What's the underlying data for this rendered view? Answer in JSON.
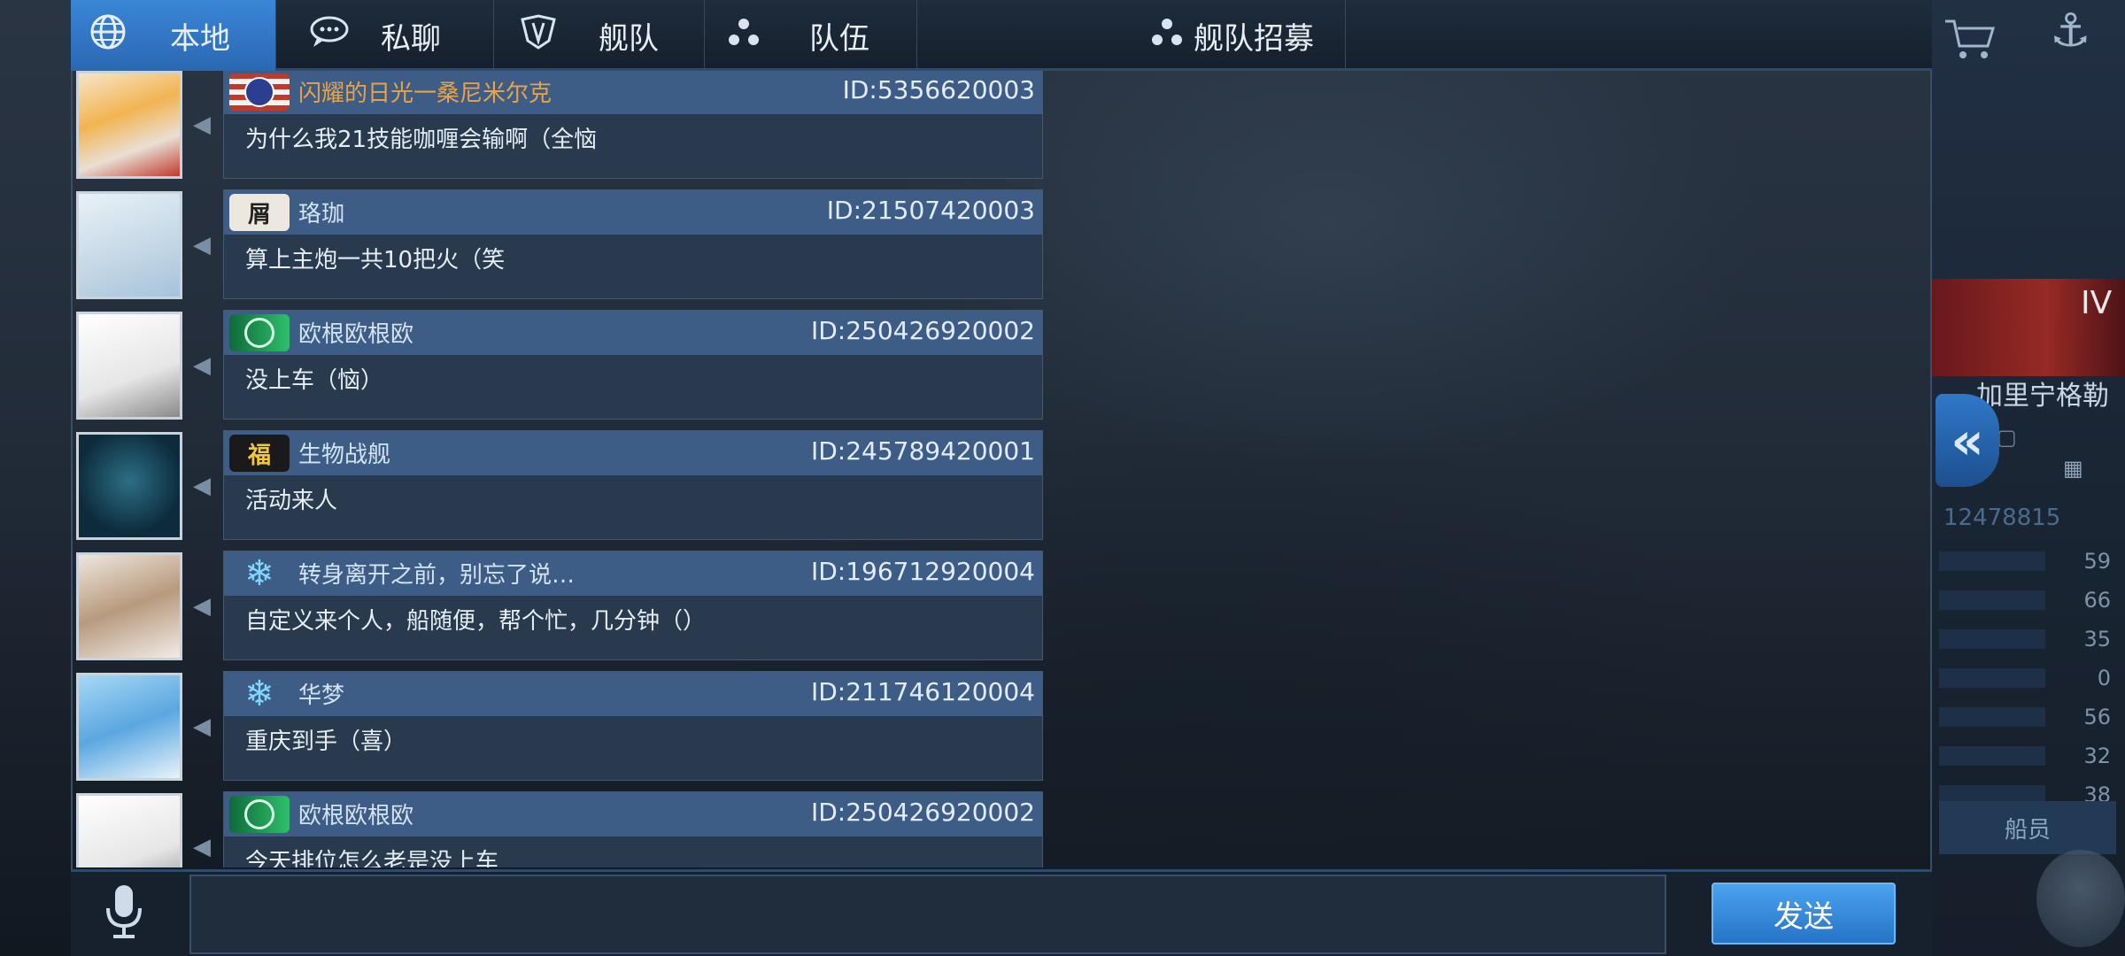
{
  "tabs": [
    {
      "label": "本地",
      "icon": "globe-icon",
      "active": true
    },
    {
      "label": "私聊",
      "icon": "chat-bubble-icon",
      "active": false
    },
    {
      "label": "舰队",
      "icon": "fleet-emblem-icon",
      "active": false
    },
    {
      "label": "队伍",
      "icon": "team-dots-icon",
      "active": false
    },
    {
      "label": "舰队招募",
      "icon": "team-dots-icon",
      "active": false
    }
  ],
  "messages": [
    {
      "name": "闪耀的日光一桑尼米尔克",
      "name_color": "#e8a24a",
      "badge": "us-flag-badge",
      "id": "ID:5356620003",
      "text": "为什么我21技能咖喱会输啊（全恼"
    },
    {
      "name": "珞珈",
      "name_color": "#d4e3f3",
      "badge": "calligraphy-badge",
      "id": "ID:21507420003",
      "text": "算上主炮一共10把火（笑"
    },
    {
      "name": "欧根欧根欧",
      "name_color": "#d4e3f3",
      "badge": "green-emblem-badge",
      "id": "ID:250426920002",
      "text": "没上车（恼）"
    },
    {
      "name": "生物战舰",
      "name_color": "#d4e3f3",
      "badge": "fu-badge",
      "badge_text": "福",
      "id": "ID:245789420001",
      "text": "活动来人"
    },
    {
      "name": "转身离开之前，别忘了说…",
      "name_color": "#d4e3f3",
      "badge": "snowflake-badge",
      "id": "ID:196712920004",
      "text": "自定义来个人，船随便，帮个忙，几分钟（）"
    },
    {
      "name": "华梦",
      "name_color": "#d4e3f3",
      "badge": "snowflake-badge",
      "id": "ID:211746120004",
      "text": "重庆到手（喜）"
    },
    {
      "name": "欧根欧根欧",
      "name_color": "#d4e3f3",
      "badge": "green-emblem-badge",
      "id": "ID:250426920002",
      "text": "今天排位怎么老是没上车"
    }
  ],
  "input": {
    "value": "",
    "placeholder": ""
  },
  "send_label": "发送",
  "right_panel": {
    "level": "IV",
    "ship_name": "加里宁格勒",
    "id_partial": "12478815",
    "stat_values": [
      "59",
      "66",
      "35",
      "0",
      "56",
      "32",
      "38"
    ],
    "crew_label": "船员"
  },
  "colors": {
    "accent": "#2a68b3",
    "send_button": "#2673c6",
    "card_header": "#3e5d86",
    "card_body": "#2a3a4e"
  }
}
